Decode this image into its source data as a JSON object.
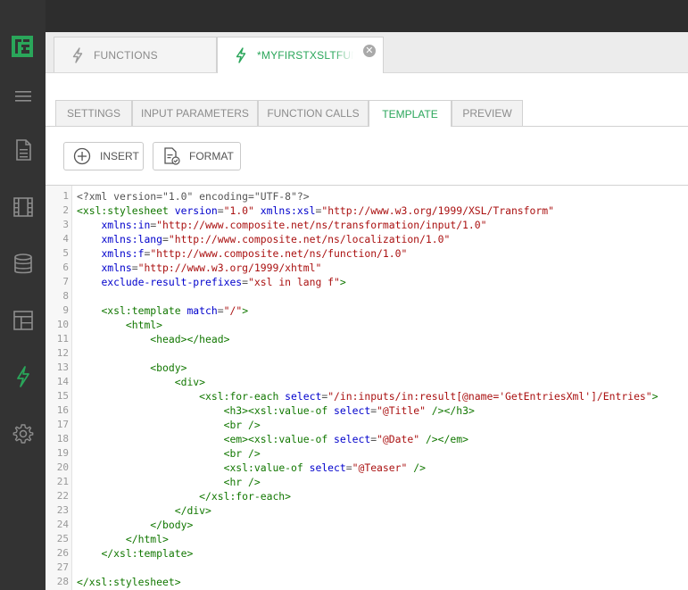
{
  "sidebar": {
    "logo": "composite-logo",
    "items": [
      {
        "icon": "menu-icon"
      },
      {
        "icon": "document-icon"
      },
      {
        "icon": "film-icon"
      },
      {
        "icon": "database-icon"
      },
      {
        "icon": "layout-icon"
      },
      {
        "icon": "lightning-icon",
        "active": true
      },
      {
        "icon": "gear-icon"
      }
    ]
  },
  "doc_tabs": [
    {
      "label": "FUNCTIONS",
      "icon": "lightning-icon",
      "active": false
    },
    {
      "label": "*MYFIRSTXSLTFUNCT",
      "icon": "lightning-icon",
      "active": true,
      "close_icon": "close-icon"
    }
  ],
  "sub_tabs": [
    {
      "label": "SETTINGS"
    },
    {
      "label": "INPUT PARAMETERS"
    },
    {
      "label": "FUNCTION CALLS"
    },
    {
      "label": "TEMPLATE",
      "active": true
    },
    {
      "label": "PREVIEW"
    }
  ],
  "toolbar": {
    "insert_label": "INSERT",
    "format_label": "FORMAT"
  },
  "colors": {
    "accent": "#2aa65a",
    "sidebar_bg": "#333333",
    "tag": "#117700",
    "attribute": "#0000cc",
    "string": "#aa1111"
  },
  "code_lines": [
    [
      [
        "p",
        "<?xml version=\"1.0\" encoding=\"UTF-8\"?>"
      ]
    ],
    [
      [
        "t",
        "<xsl:stylesheet"
      ],
      [
        "p",
        " "
      ],
      [
        "a",
        "version"
      ],
      [
        "p",
        "="
      ],
      [
        "s",
        "\"1.0\""
      ],
      [
        "p",
        " "
      ],
      [
        "a",
        "xmlns:xsl"
      ],
      [
        "p",
        "="
      ],
      [
        "s",
        "\"http://www.w3.org/1999/XSL/Transform\""
      ]
    ],
    [
      [
        "p",
        "    "
      ],
      [
        "a",
        "xmlns:in"
      ],
      [
        "p",
        "="
      ],
      [
        "s",
        "\"http://www.composite.net/ns/transformation/input/1.0\""
      ]
    ],
    [
      [
        "p",
        "    "
      ],
      [
        "a",
        "xmlns:lang"
      ],
      [
        "p",
        "="
      ],
      [
        "s",
        "\"http://www.composite.net/ns/localization/1.0\""
      ]
    ],
    [
      [
        "p",
        "    "
      ],
      [
        "a",
        "xmlns:f"
      ],
      [
        "p",
        "="
      ],
      [
        "s",
        "\"http://www.composite.net/ns/function/1.0\""
      ]
    ],
    [
      [
        "p",
        "    "
      ],
      [
        "a",
        "xmlns"
      ],
      [
        "p",
        "="
      ],
      [
        "s",
        "\"http://www.w3.org/1999/xhtml\""
      ]
    ],
    [
      [
        "p",
        "    "
      ],
      [
        "a",
        "exclude-result-prefixes"
      ],
      [
        "p",
        "="
      ],
      [
        "s",
        "\"xsl in lang f\""
      ],
      [
        "t",
        ">"
      ]
    ],
    [],
    [
      [
        "p",
        "    "
      ],
      [
        "t",
        "<xsl:template"
      ],
      [
        "p",
        " "
      ],
      [
        "a",
        "match"
      ],
      [
        "p",
        "="
      ],
      [
        "s",
        "\"/\""
      ],
      [
        "t",
        ">"
      ]
    ],
    [
      [
        "p",
        "        "
      ],
      [
        "t",
        "<html>"
      ]
    ],
    [
      [
        "p",
        "            "
      ],
      [
        "t",
        "<head></head>"
      ]
    ],
    [],
    [
      [
        "p",
        "            "
      ],
      [
        "t",
        "<body>"
      ]
    ],
    [
      [
        "p",
        "                "
      ],
      [
        "t",
        "<div>"
      ]
    ],
    [
      [
        "p",
        "                    "
      ],
      [
        "t",
        "<xsl:for-each"
      ],
      [
        "p",
        " "
      ],
      [
        "a",
        "select"
      ],
      [
        "p",
        "="
      ],
      [
        "s",
        "\"/in:inputs/in:result[@name='GetEntriesXml']/Entries\""
      ],
      [
        "t",
        ">"
      ]
    ],
    [
      [
        "p",
        "                        "
      ],
      [
        "t",
        "<h3><xsl:value-of"
      ],
      [
        "p",
        " "
      ],
      [
        "a",
        "select"
      ],
      [
        "p",
        "="
      ],
      [
        "s",
        "\"@Title\""
      ],
      [
        "p",
        " "
      ],
      [
        "t",
        "/></h3>"
      ]
    ],
    [
      [
        "p",
        "                        "
      ],
      [
        "t",
        "<br />"
      ]
    ],
    [
      [
        "p",
        "                        "
      ],
      [
        "t",
        "<em><xsl:value-of"
      ],
      [
        "p",
        " "
      ],
      [
        "a",
        "select"
      ],
      [
        "p",
        "="
      ],
      [
        "s",
        "\"@Date\""
      ],
      [
        "p",
        " "
      ],
      [
        "t",
        "/></em>"
      ]
    ],
    [
      [
        "p",
        "                        "
      ],
      [
        "t",
        "<br />"
      ]
    ],
    [
      [
        "p",
        "                        "
      ],
      [
        "t",
        "<xsl:value-of"
      ],
      [
        "p",
        " "
      ],
      [
        "a",
        "select"
      ],
      [
        "p",
        "="
      ],
      [
        "s",
        "\"@Teaser\""
      ],
      [
        "p",
        " "
      ],
      [
        "t",
        "/>"
      ]
    ],
    [
      [
        "p",
        "                        "
      ],
      [
        "t",
        "<hr />"
      ]
    ],
    [
      [
        "p",
        "                    "
      ],
      [
        "t",
        "</xsl:for-each>"
      ]
    ],
    [
      [
        "p",
        "                "
      ],
      [
        "t",
        "</div>"
      ]
    ],
    [
      [
        "p",
        "            "
      ],
      [
        "t",
        "</body>"
      ]
    ],
    [
      [
        "p",
        "        "
      ],
      [
        "t",
        "</html>"
      ]
    ],
    [
      [
        "p",
        "    "
      ],
      [
        "t",
        "</xsl:template>"
      ]
    ],
    [],
    [
      [
        "t",
        "</xsl:stylesheet>"
      ]
    ]
  ]
}
